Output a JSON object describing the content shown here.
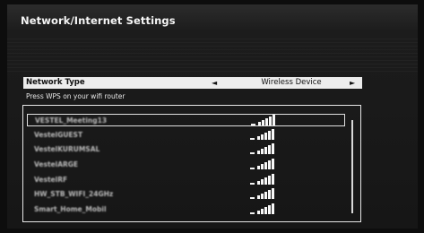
{
  "title": "Network/Internet Settings",
  "network_type": {
    "label": "Network Type",
    "value": "Wireless Device",
    "left_arrow": "◄",
    "right_arrow": "►"
  },
  "wps_hint": "Press WPS on your wifi router",
  "networks": [
    {
      "ssid": "VESTEL_Meeting13",
      "signal_bars": 5,
      "selected": true
    },
    {
      "ssid": "VestelGUEST",
      "signal_bars": 5,
      "selected": false
    },
    {
      "ssid": "VestelKURUMSAL",
      "signal_bars": 5,
      "selected": false
    },
    {
      "ssid": "VestelARGE",
      "signal_bars": 5,
      "selected": false
    },
    {
      "ssid": "VestelRF",
      "signal_bars": 5,
      "selected": false
    },
    {
      "ssid": "HW_STB_WIFI_24GHz",
      "signal_bars": 5,
      "selected": false
    },
    {
      "ssid": "Smart_Home_Mobil",
      "signal_bars": 5,
      "selected": false
    }
  ],
  "icons": {
    "signal": "wifi-signal-icon",
    "left": "arrow-left-icon",
    "right": "arrow-right-icon"
  }
}
